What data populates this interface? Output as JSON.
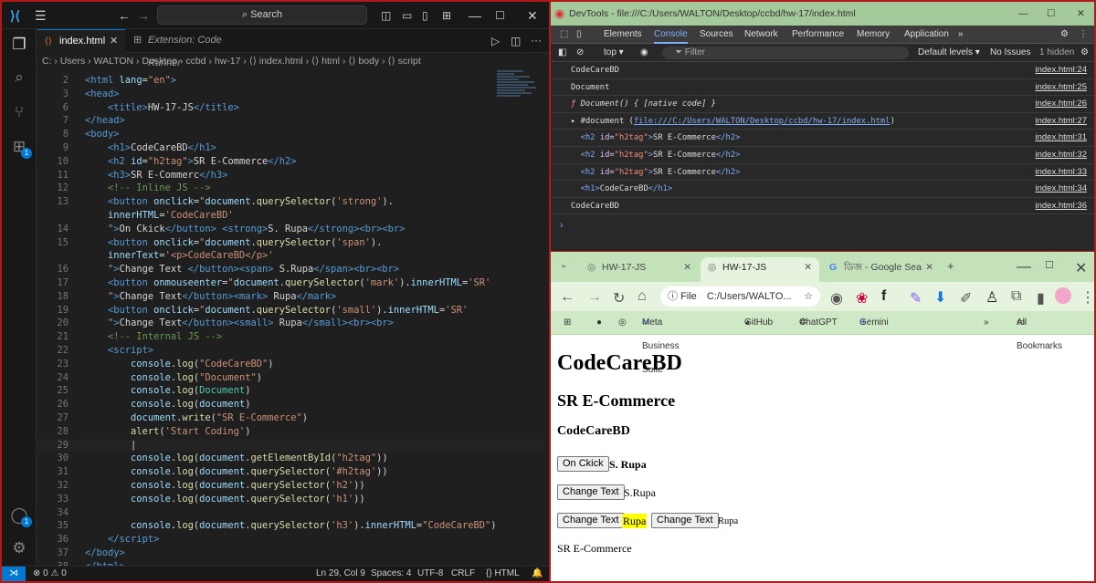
{
  "vscode": {
    "search": "Search",
    "tabs": [
      "index.html",
      "Extension: Code Runner"
    ],
    "breadcrumb": "C: › Users › WALTON › Desktop › ccbd › hw-17 › ⟨⟩ index.html › ⟨⟩ html › ⟨⟩ body › ⟨⟩ script",
    "badge_ext": "1",
    "badge_account": "1",
    "lines": [
      {
        "n": "2",
        "html": "<span class='tag'>&lt;html</span> <span class='attr'>lang</span><span class='pun'>=</span><span class='str'>\"en\"</span><span class='tag'>&gt;</span>"
      },
      {
        "n": "3",
        "html": "<span class='tag'>&lt;head&gt;</span>"
      },
      {
        "n": "6",
        "html": "    <span class='tag'>&lt;title&gt;</span><span class='txt'>HW-17-JS</span><span class='tag'>&lt;/title&gt;</span>"
      },
      {
        "n": "7",
        "html": "<span class='tag'>&lt;/head&gt;</span>"
      },
      {
        "n": "8",
        "html": "<span class='tag'>&lt;body&gt;</span>"
      },
      {
        "n": "9",
        "html": "    <span class='tag'>&lt;h1&gt;</span><span class='txt'>CodeCareBD</span><span class='tag'>&lt;/h1&gt;</span>"
      },
      {
        "n": "10",
        "html": "    <span class='tag'>&lt;h2</span> <span class='attr'>id</span><span class='pun'>=</span><span class='str'>\"h2tag\"</span><span class='tag'>&gt;</span><span class='txt'>SR E-Commerce</span><span class='tag'>&lt;/h2&gt;</span>"
      },
      {
        "n": "11",
        "html": "    <span class='tag'>&lt;h3&gt;</span><span class='txt'>SR E-Commerc</span><span class='tag'>&lt;/h3&gt;</span>"
      },
      {
        "n": "12",
        "html": "    <span class='cmt'>&lt;!-- Inline JS --&gt;</span>"
      },
      {
        "n": "13",
        "html": "    <span class='tag'>&lt;button</span> <span class='attr'>onclick</span><span class='pun'>=</span><span class='str'>\"</span><span class='var'>document</span><span class='pun'>.</span><span class='fn'>querySelector</span><span class='pun'>(</span><span class='str'>'strong'</span><span class='pun'>).</span>"
      },
      {
        "n": "",
        "html": "    <span class='var'>innerHTML</span><span class='pun'>=</span><span class='str'>'CodeCareBD'</span>"
      },
      {
        "n": "14",
        "html": "    <span class='str'>\"</span><span class='tag'>&gt;</span><span class='txt'>On Ckick</span><span class='tag'>&lt;/button&gt;</span> <span class='tag'>&lt;strong&gt;</span><span class='txt'>S. Rupa</span><span class='tag'>&lt;/strong&gt;&lt;br&gt;&lt;br&gt;</span>"
      },
      {
        "n": "15",
        "html": "    <span class='tag'>&lt;button</span> <span class='attr'>onclick</span><span class='pun'>=</span><span class='str'>\"</span><span class='var'>document</span><span class='pun'>.</span><span class='fn'>querySelector</span><span class='pun'>(</span><span class='str'>'span'</span><span class='pun'>).</span>"
      },
      {
        "n": "",
        "html": "    <span class='var'>innerText</span><span class='pun'>=</span><span class='str'>'&lt;p&gt;CodeCareBD&lt;/p&gt;'</span>"
      },
      {
        "n": "16",
        "html": "    <span class='str'>\"</span><span class='tag'>&gt;</span><span class='txt'>Change Text </span><span class='tag'>&lt;/button&gt;&lt;span&gt;</span><span class='txt'> S.Rupa</span><span class='tag'>&lt;/span&gt;&lt;br&gt;&lt;br&gt;</span>"
      },
      {
        "n": "17",
        "html": "    <span class='tag'>&lt;button</span> <span class='attr'>onmouseenter</span><span class='pun'>=</span><span class='str'>\"</span><span class='var'>document</span><span class='pun'>.</span><span class='fn'>querySelector</span><span class='pun'>(</span><span class='str'>'mark'</span><span class='pun'>).</span><span class='var'>innerHTML</span><span class='pun'>=</span><span class='str'>'SR'</span>"
      },
      {
        "n": "18",
        "html": "    <span class='str'>\"</span><span class='tag'>&gt;</span><span class='txt'>Change Text</span><span class='tag'>&lt;/button&gt;&lt;mark&gt;</span><span class='txt'> Rupa</span><span class='tag'>&lt;/mark&gt;</span>"
      },
      {
        "n": "19",
        "html": "    <span class='tag'>&lt;button</span> <span class='attr'>onclick</span><span class='pun'>=</span><span class='str'>\"</span><span class='var'>document</span><span class='pun'>.</span><span class='fn'>querySelector</span><span class='pun'>(</span><span class='str'>'small'</span><span class='pun'>).</span><span class='var'>innerHTML</span><span class='pun'>=</span><span class='str'>'SR'</span>"
      },
      {
        "n": "20",
        "html": "    <span class='str'>\"</span><span class='tag'>&gt;</span><span class='txt'>Change Text</span><span class='tag'>&lt;/button&gt;&lt;small&gt;</span><span class='txt'> Rupa</span><span class='tag'>&lt;/small&gt;&lt;br&gt;&lt;br&gt;</span>"
      },
      {
        "n": "21",
        "html": "    <span class='cmt'>&lt;!-- Internal JS --&gt;</span>"
      },
      {
        "n": "22",
        "html": "    <span class='tag'>&lt;script&gt;</span>"
      },
      {
        "n": "23",
        "html": "        <span class='var'>console</span><span class='pun'>.</span><span class='fn'>log</span><span class='pun'>(</span><span class='str'>\"CodeCareBD\"</span><span class='pun'>)</span>"
      },
      {
        "n": "24",
        "html": "        <span class='var'>console</span><span class='pun'>.</span><span class='fn'>log</span><span class='pun'>(</span><span class='str'>\"Document\"</span><span class='pun'>)</span>"
      },
      {
        "n": "25",
        "html": "        <span class='var'>console</span><span class='pun'>.</span><span class='fn'>log</span><span class='pun'>(</span><span class='cls'>Document</span><span class='pun'>)</span>"
      },
      {
        "n": "26",
        "html": "        <span class='var'>console</span><span class='pun'>.</span><span class='fn'>log</span><span class='pun'>(</span><span class='var'>document</span><span class='pun'>)</span>"
      },
      {
        "n": "27",
        "html": "        <span class='var'>document</span><span class='pun'>.</span><span class='fn'>write</span><span class='pun'>(</span><span class='str'>\"SR E-Commerce\"</span><span class='pun'>)</span>"
      },
      {
        "n": "28",
        "html": "        <span class='fn'>alert</span><span class='pun'>(</span><span class='str'>'Start Coding'</span><span class='pun'>)</span>"
      },
      {
        "n": "29",
        "html": "        <span class='txt'>|</span>",
        "current": true
      },
      {
        "n": "30",
        "html": "        <span class='var'>console</span><span class='pun'>.</span><span class='fn'>log</span><span class='pun'>(</span><span class='var'>document</span><span class='pun'>.</span><span class='fn'>getElementById</span><span class='pun'>(</span><span class='str'>\"h2tag\"</span><span class='pun'>))</span>"
      },
      {
        "n": "31",
        "html": "        <span class='var'>console</span><span class='pun'>.</span><span class='fn'>log</span><span class='pun'>(</span><span class='var'>document</span><span class='pun'>.</span><span class='fn'>querySelector</span><span class='pun'>(</span><span class='str'>'#h2tag'</span><span class='pun'>))</span>"
      },
      {
        "n": "32",
        "html": "        <span class='var'>console</span><span class='pun'>.</span><span class='fn'>log</span><span class='pun'>(</span><span class='var'>document</span><span class='pun'>.</span><span class='fn'>querySelector</span><span class='pun'>(</span><span class='str'>'h2'</span><span class='pun'>))</span>"
      },
      {
        "n": "33",
        "html": "        <span class='var'>console</span><span class='pun'>.</span><span class='fn'>log</span><span class='pun'>(</span><span class='var'>document</span><span class='pun'>.</span><span class='fn'>querySelector</span><span class='pun'>(</span><span class='str'>'h1'</span><span class='pun'>))</span>"
      },
      {
        "n": "34",
        "html": ""
      },
      {
        "n": "35",
        "html": "        <span class='var'>console</span><span class='pun'>.</span><span class='fn'>log</span><span class='pun'>(</span><span class='var'>document</span><span class='pun'>.</span><span class='fn'>querySelector</span><span class='pun'>(</span><span class='str'>'h3'</span><span class='pun'>).</span><span class='var'>innerHTML</span><span class='pun'>=</span><span class='str'>\"CodeCareBD\"</span><span class='pun'>)</span>"
      },
      {
        "n": "36",
        "html": "    <span class='tag'>&lt;/script&gt;</span>"
      },
      {
        "n": "37",
        "html": "<span class='tag'>&lt;/body&gt;</span>"
      },
      {
        "n": "38",
        "html": "<span class='tag'>&lt;/html&gt;</span>"
      }
    ],
    "status": {
      "problems": "⊗ 0 ⚠ 0",
      "position": "Ln 29, Col 9",
      "spaces": "Spaces: 4",
      "encoding": "UTF-8",
      "eol": "CRLF",
      "language": "{} HTML",
      "remote_icon": "⋊"
    }
  },
  "devtools": {
    "title": "DevTools - file:///C:/Users/WALTON/Desktop/ccbd/hw-17/index.html",
    "tabs": [
      "Elements",
      "Console",
      "Sources",
      "Network",
      "Performance",
      "Memory",
      "Application"
    ],
    "context": "top ▾",
    "filter": "Filter",
    "levels": "Default levels ▾",
    "issues": "No Issues",
    "hidden": "1 hidden",
    "rows": [
      {
        "html": "CodeCareBD",
        "src": "index.html:24"
      },
      {
        "html": "Document",
        "src": "index.html:25"
      },
      {
        "html": "<span class='italic'><span style='color:#f28b82'>ƒ</span> Document() { [native code] }</span>",
        "src": "index.html:26"
      },
      {
        "html": "▸ #document (<span style='color:#7cacf8;text-decoration:underline'>file:///C:/Users/WALTON/Desktop/ccbd/hw-17/index.html</span>)",
        "src": "index.html:27"
      },
      {
        "html": "  <span class='el-tag'>&lt;h2</span> <span class='el-attr'>id</span>=<span class='el-val'>\"h2tag\"</span><span class='el-tag'>&gt;</span>SR E-Commerce<span class='el-tag'>&lt;/h2&gt;</span>",
        "src": "index.html:31"
      },
      {
        "html": "  <span class='el-tag'>&lt;h2</span> <span class='el-attr'>id</span>=<span class='el-val'>\"h2tag\"</span><span class='el-tag'>&gt;</span>SR E-Commerce<span class='el-tag'>&lt;/h2&gt;</span>",
        "src": "index.html:32"
      },
      {
        "html": "  <span class='el-tag'>&lt;h2</span> <span class='el-attr'>id</span>=<span class='el-val'>\"h2tag\"</span><span class='el-tag'>&gt;</span>SR E-Commerce<span class='el-tag'>&lt;/h2&gt;</span>",
        "src": "index.html:33"
      },
      {
        "html": "  <span class='el-tag'>&lt;h1&gt;</span>CodeCareBD<span class='el-tag'>&lt;/h1&gt;</span>",
        "src": "index.html:34"
      },
      {
        "html": "CodeCareBD",
        "src": "index.html:36"
      }
    ],
    "prompt": "›"
  },
  "chrome": {
    "tabs": [
      "HW-17-JS",
      "HW-17-JS",
      "ডিজ - Google Sea"
    ],
    "omnibox_chip": "File",
    "omnibox_url": "C:/Users/WALTO...",
    "bookmarks": [
      "Meta Business Suite",
      "GitHub",
      "ChatGPT",
      "Gemini"
    ],
    "all_bookmarks": "All Bookmarks",
    "page": {
      "h1": "CodeCareBD",
      "h2": "SR E-Commerce",
      "h3": "CodeCareBD",
      "btn1": "On Ckick",
      "strong": "S. Rupa",
      "btn2": "Change Text",
      "span": "S.Rupa",
      "btn3": "Change Text",
      "mark": "Rupa",
      "btn4": "Change Text",
      "small": "Rupa",
      "written": "SR E-Commerce"
    }
  }
}
